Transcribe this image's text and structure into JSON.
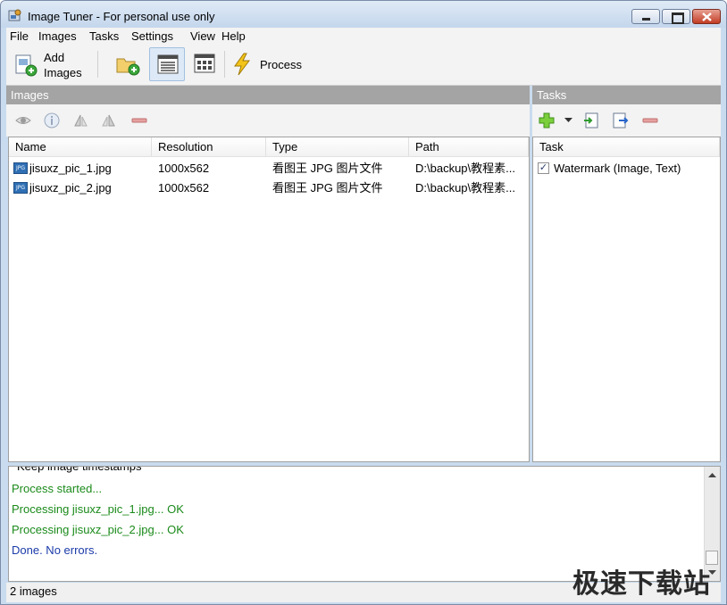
{
  "window": {
    "title": "Image Tuner - For personal use only"
  },
  "menu": [
    "File",
    "Images",
    "Tasks",
    "Settings",
    "View",
    "Help"
  ],
  "toolbar": {
    "add_images_line1": "Add",
    "add_images_line2": "Images",
    "process_label": "Process"
  },
  "images_panel": {
    "header": "Images",
    "columns": [
      "Name",
      "Resolution",
      "Type",
      "Path"
    ],
    "rows": [
      {
        "name": "jisuxz_pic_1.jpg",
        "resolution": "1000x562",
        "type": "看图王 JPG 图片文件",
        "path": "D:\\backup\\教程素..."
      },
      {
        "name": "jisuxz_pic_2.jpg",
        "resolution": "1000x562",
        "type": "看图王 JPG 图片文件",
        "path": "D:\\backup\\教程素..."
      }
    ],
    "file_icon_text": "JPG"
  },
  "tasks_panel": {
    "header": "Tasks",
    "column": "Task",
    "items": [
      {
        "label": "Watermark (Image, Text)",
        "checked": true,
        "check_glyph": "✓"
      }
    ]
  },
  "log": {
    "lines": [
      {
        "text": "Keep image timestamps",
        "color": "#000000"
      },
      {
        "text": "Process started...",
        "color": "#1a8a1a"
      },
      {
        "text": "Processing jisuxz_pic_1.jpg... OK",
        "color": "#1a8a1a"
      },
      {
        "text": "Processing jisuxz_pic_2.jpg... OK",
        "color": "#1a8a1a"
      },
      {
        "text": "Done. No errors.",
        "color": "#1a3aa8"
      }
    ]
  },
  "status": {
    "text": "2 images"
  },
  "watermark": {
    "text": "极速下载站"
  },
  "colors": {
    "panel_header": "#a4a4a4",
    "log_ok": "#1a8a1a",
    "log_done": "#1a3aa8"
  }
}
